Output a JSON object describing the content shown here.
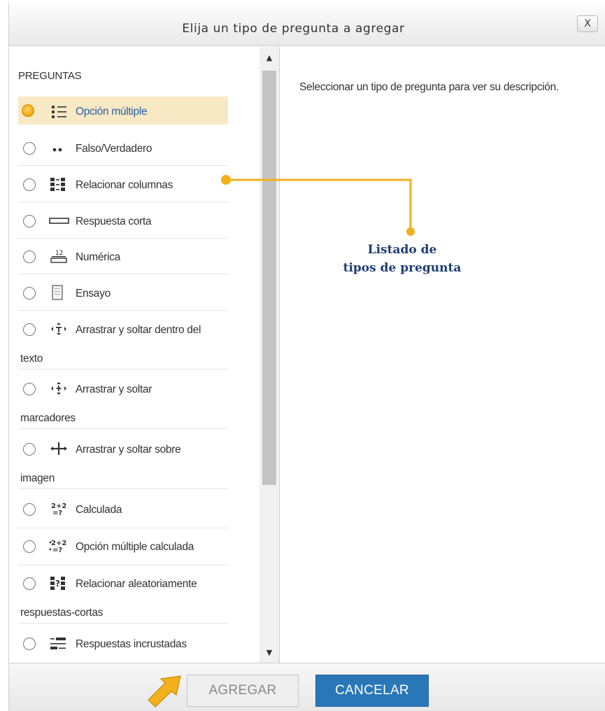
{
  "dialog": {
    "title": "Elija un tipo de pregunta a agregar",
    "close_label": "X"
  },
  "section": {
    "heading": "PREGUNTAS"
  },
  "question_types": [
    {
      "icon": "multiple-choice-icon",
      "label": "Opción múltiple",
      "selected": true
    },
    {
      "icon": "true-false-icon",
      "label": "Falso/Verdadero",
      "selected": false
    },
    {
      "icon": "matching-icon",
      "label": "Relacionar columnas",
      "selected": false
    },
    {
      "icon": "short-answer-icon",
      "label": "Respuesta corta",
      "selected": false
    },
    {
      "icon": "numerical-icon",
      "label": "Numérica",
      "selected": false
    },
    {
      "icon": "essay-icon",
      "label": "Ensayo",
      "selected": false
    },
    {
      "icon": "drag-drop-text-icon",
      "label": "Arrastrar y soltar dentro del",
      "label2": "texto",
      "selected": false
    },
    {
      "icon": "drag-drop-markers-icon",
      "label": "Arrastrar y soltar",
      "label2": "marcadores",
      "selected": false
    },
    {
      "icon": "drag-drop-image-icon",
      "label": "Arrastrar y soltar sobre",
      "label2": "imagen",
      "selected": false
    },
    {
      "icon": "calculated-icon",
      "label": "Calculada",
      "selected": false
    },
    {
      "icon": "calculated-multichoice-icon",
      "label": "Opción múltiple calculada",
      "selected": false
    },
    {
      "icon": "random-short-answer-matching-icon",
      "label": "Relacionar aleatoriamente",
      "label2": "respuestas-cortas",
      "selected": false
    },
    {
      "icon": "embedded-answers-icon",
      "label": "Respuestas incrustadas",
      "selected": false
    }
  ],
  "description": "Seleccionar un tipo de pregunta para ver su descripción.",
  "annotation": {
    "line1": "Listado de",
    "line2": "tipos de pregunta",
    "color": "#f2b01d"
  },
  "footer": {
    "add_label": "AGREGAR",
    "cancel_label": "CANCELAR"
  },
  "colors": {
    "selected_bg": "#f6e9c4",
    "cancel_bg": "#2a77b8",
    "annotation_text": "#1d3e73"
  }
}
